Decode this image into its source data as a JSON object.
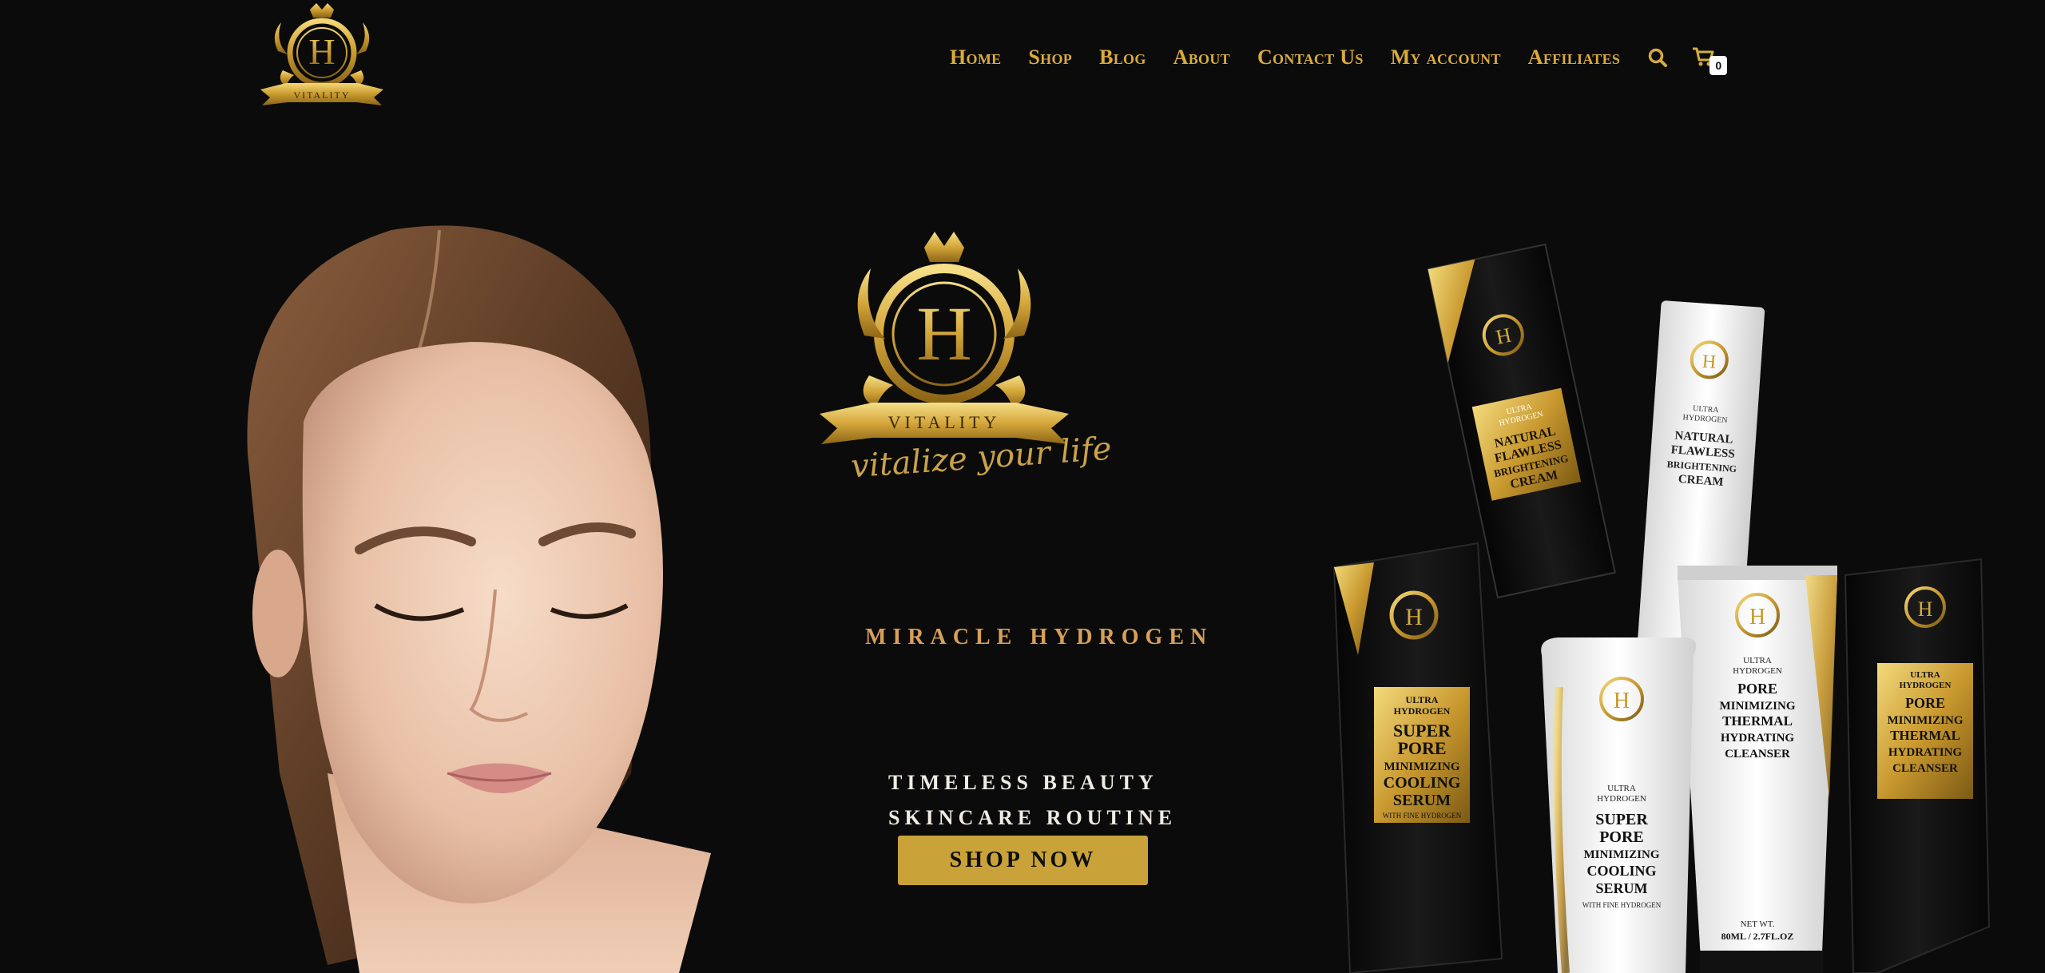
{
  "brand": {
    "name": "Vitality",
    "emblem_letter": "H",
    "ribbon_text": "VITALITY",
    "script_tagline": "vitalize your life"
  },
  "nav": {
    "items": [
      {
        "label": "Home"
      },
      {
        "label": "Shop"
      },
      {
        "label": "Blog"
      },
      {
        "label": "About"
      },
      {
        "label": "Contact Us"
      },
      {
        "label": "My account"
      },
      {
        "label": "Affiliates"
      }
    ],
    "search_icon": "search-icon",
    "cart_icon": "cart-icon",
    "cart_count": "0"
  },
  "hero": {
    "headline": "MIRACLE HYDROGEN",
    "subline_1": "TIMELESS BEAUTY",
    "subline_2": "SKINCARE ROUTINE",
    "cta_label": "SHOP NOW"
  },
  "products": {
    "box_back": {
      "line1": "ULTRA",
      "line2": "HYDROGEN",
      "name": [
        "NATURAL",
        "FLAWLESS",
        "BRIGHTENING",
        "CREAM"
      ]
    },
    "tube_back": {
      "line1": "ULTRA",
      "line2": "HYDROGEN",
      "name": [
        "NATURAL",
        "FLAWLESS",
        "BRIGHTENING",
        "CREAM"
      ]
    },
    "box_left": {
      "line1": "ULTRA",
      "line2": "HYDROGEN",
      "name": [
        "SUPER",
        "PORE",
        "MINIMIZING",
        "COOLING",
        "SERUM"
      ],
      "sub": "WITH FINE HYDROGEN"
    },
    "tube_front_left": {
      "line1": "ULTRA",
      "line2": "HYDROGEN",
      "name": [
        "SUPER",
        "PORE",
        "MINIMIZING",
        "COOLING",
        "SERUM"
      ],
      "sub": "WITH FINE HYDROGEN"
    },
    "tube_front_right": {
      "line1": "ULTRA",
      "line2": "HYDROGEN",
      "name": [
        "PORE",
        "MINIMIZING",
        "THERMAL",
        "HYDRATING",
        "CLEANSER"
      ],
      "net": "NET WT.",
      "volume": "80ML / 2.7FL.OZ"
    },
    "box_right": {
      "line1": "ULTRA",
      "line2": "HYDROGEN",
      "name": [
        "PORE",
        "MINIMIZING",
        "THERMAL",
        "HYDRATING",
        "CLEANSER"
      ]
    }
  },
  "colors": {
    "background": "#0b0b0b",
    "gold": "#d4ac3e",
    "cta": "#c9a339",
    "headline": "#d7a05a",
    "subline": "#f0ece4"
  }
}
